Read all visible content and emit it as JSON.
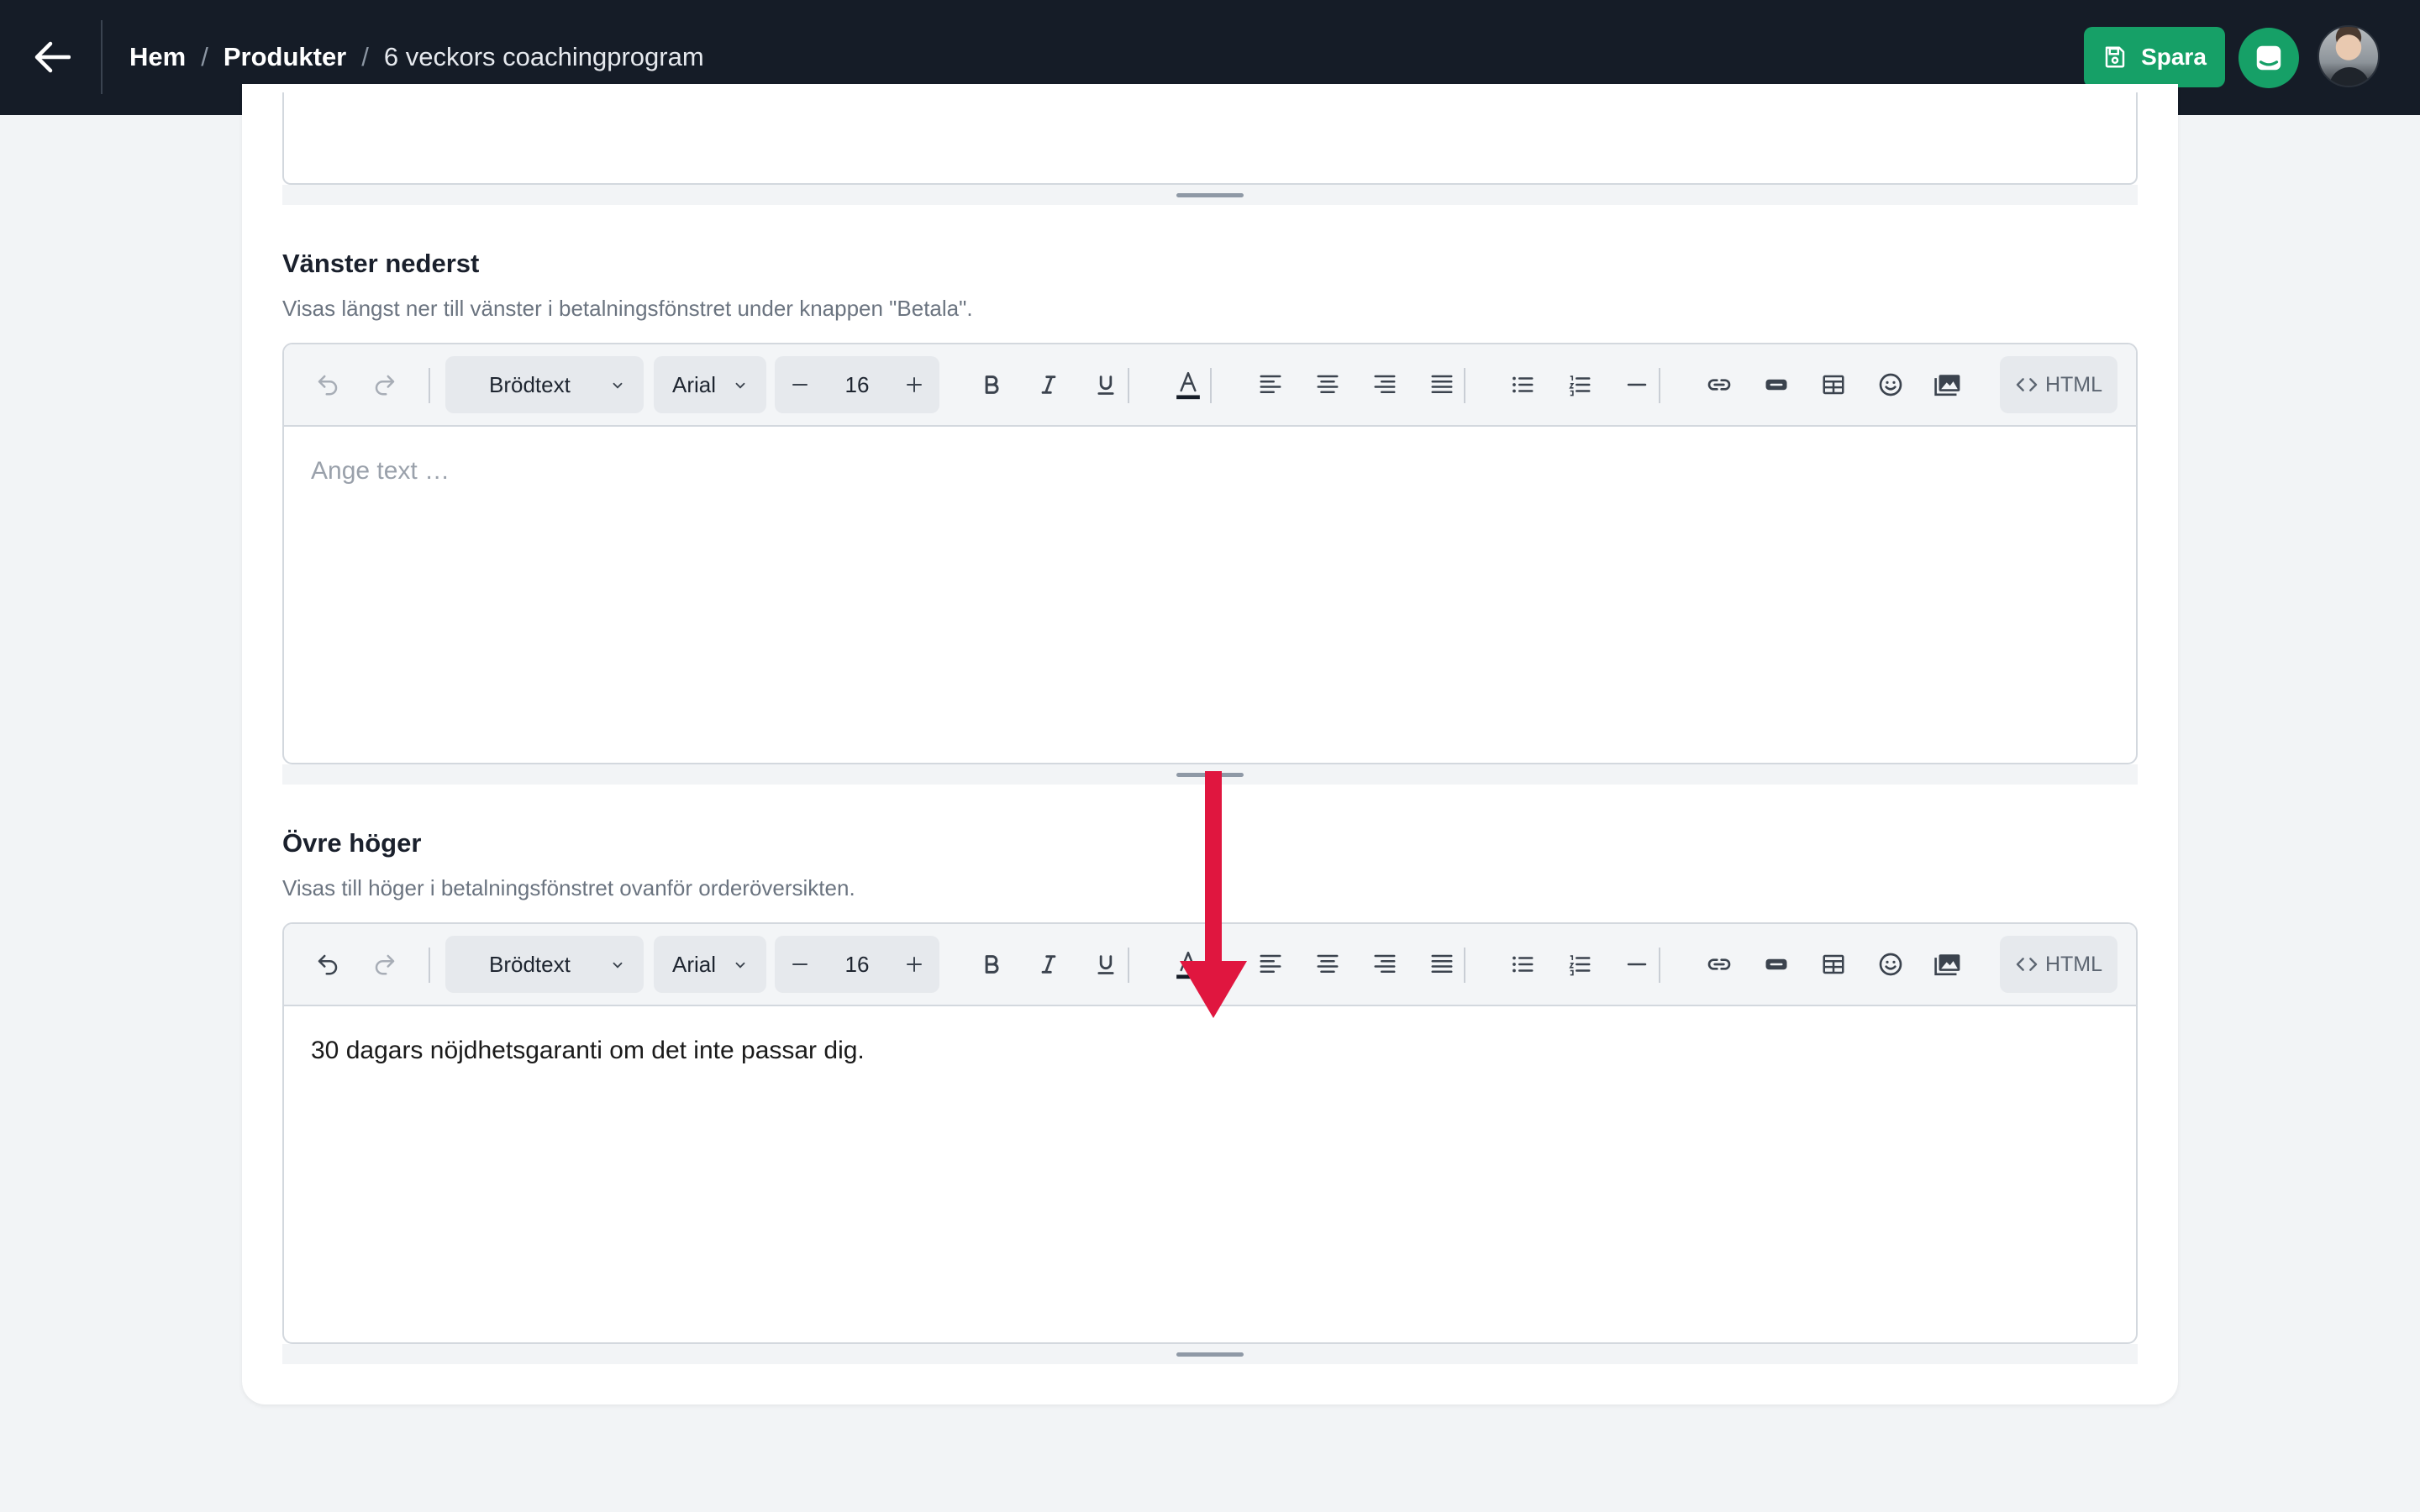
{
  "header": {
    "breadcrumb": {
      "home": "Hem",
      "products": "Produkter",
      "current": "6 veckors coachingprogram",
      "separator": "/"
    },
    "save_label": "Spara",
    "accent_color": "#16a067",
    "background_color": "#151c27"
  },
  "sections": [
    {
      "title": "Vänster nederst",
      "description": "Visas längst ner till vänster i betalningsfönstret under knappen \"Betala\".",
      "placeholder": "Ange text …",
      "content": ""
    },
    {
      "title": "Övre höger",
      "description": "Visas till höger i betalningsfönstret ovanför orderöversikten.",
      "placeholder": "",
      "content": "30 dagars nöjdhetsgaranti om det inte passar dig."
    }
  ],
  "toolbar": {
    "block_style": "Brödtext",
    "font": "Arial",
    "font_size": "16",
    "html_label": "HTML",
    "icons": [
      "undo-icon",
      "redo-icon",
      "bold-icon",
      "italic-icon",
      "underline-icon",
      "text-color-icon",
      "align-left-icon",
      "align-center-icon",
      "align-right-icon",
      "align-justify-icon",
      "bullet-list-icon",
      "numbered-list-icon",
      "horizontal-rule-icon",
      "link-icon",
      "button-icon",
      "table-icon",
      "emoji-icon",
      "image-icon",
      "code-icon"
    ]
  },
  "annotation": {
    "arrow_color": "#e0163f"
  }
}
